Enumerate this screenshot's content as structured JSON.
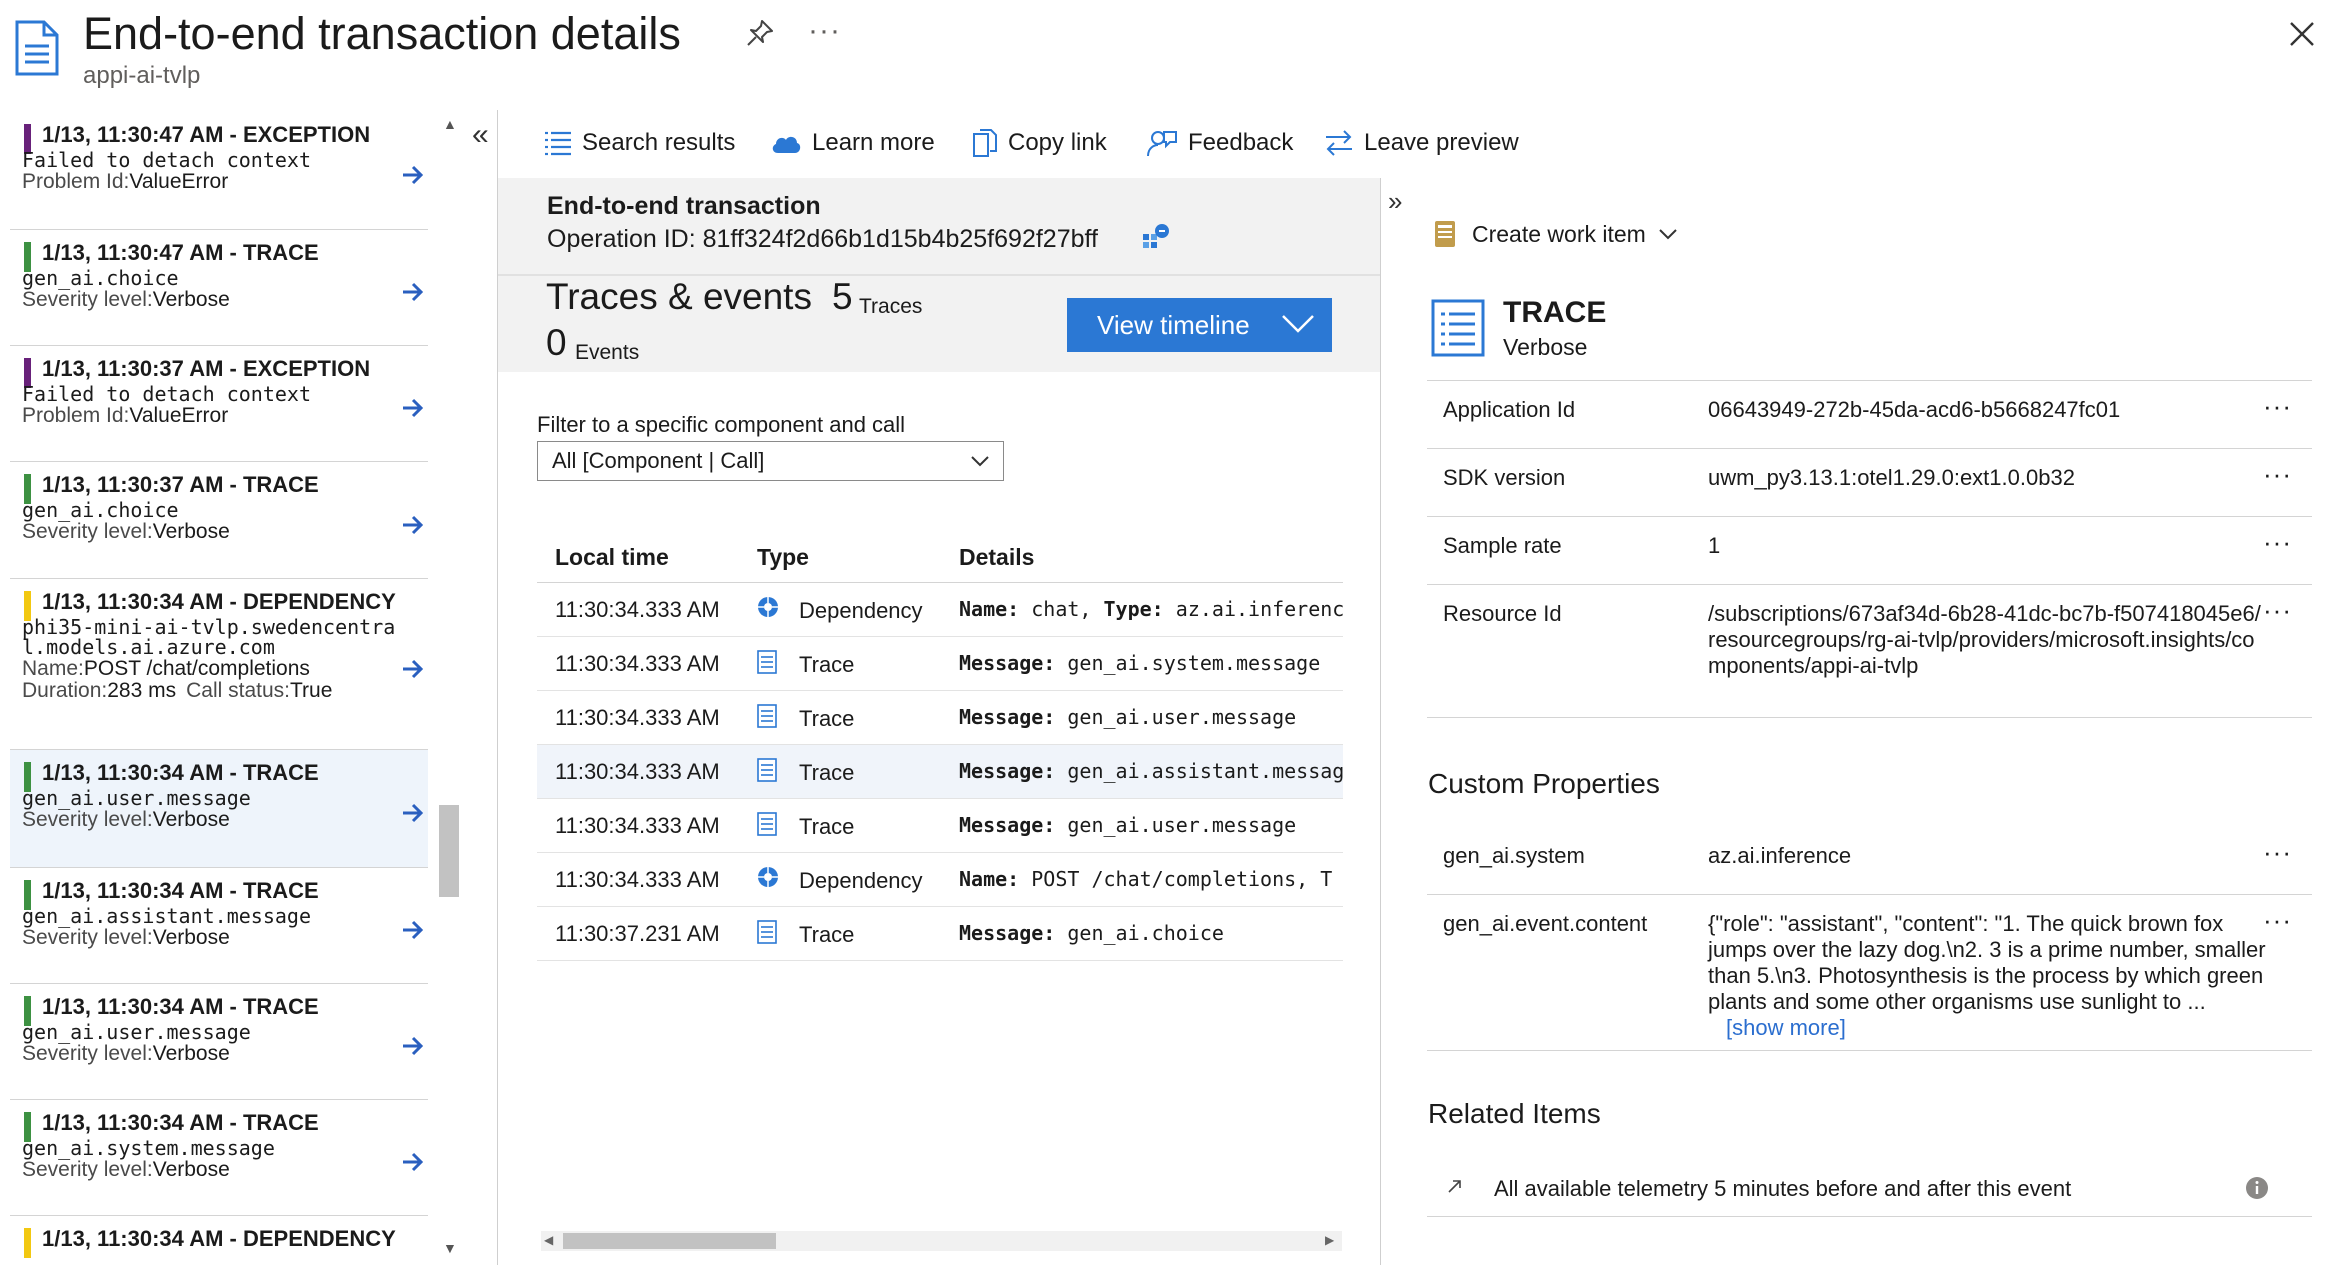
{
  "header": {
    "title": "End-to-end transaction details",
    "subtitle": "appi-ai-tvlp",
    "more": "···"
  },
  "left_list": {
    "items": [
      {
        "kind": "exception",
        "color": "#68217a",
        "title": "1/13, 11:30:47 AM - EXCEPTION",
        "lines": [
          {
            "mono": "Failed to detach context"
          },
          {
            "label": "Problem Id:",
            "value": "ValueError"
          }
        ]
      },
      {
        "kind": "trace",
        "color": "#3d9142",
        "title": "1/13, 11:30:47 AM - TRACE",
        "lines": [
          {
            "mono": "gen_ai.choice"
          },
          {
            "label": "Severity level:",
            "value": "Verbose"
          }
        ]
      },
      {
        "kind": "exception",
        "color": "#68217a",
        "title": "1/13, 11:30:37 AM - EXCEPTION",
        "lines": [
          {
            "mono": "Failed to detach context"
          },
          {
            "label": "Problem Id:",
            "value": "ValueError"
          }
        ]
      },
      {
        "kind": "trace",
        "color": "#3d9142",
        "title": "1/13, 11:30:37 AM - TRACE",
        "lines": [
          {
            "mono": "gen_ai.choice"
          },
          {
            "label": "Severity level:",
            "value": "Verbose"
          }
        ]
      },
      {
        "kind": "dependency",
        "color": "#f2c811",
        "title": "1/13, 11:30:34 AM - DEPENDENCY",
        "lines": [
          {
            "mono": "phi35-mini-ai-tvlp.swedencentra"
          },
          {
            "mono": "l.models.ai.azure.com"
          },
          {
            "label": "Name:",
            "value": "POST /chat/completions"
          },
          {
            "label": "Duration:",
            "value": "283 ms",
            "label2": "Call status:",
            "value2": "True"
          }
        ]
      },
      {
        "kind": "trace",
        "color": "#3d9142",
        "title": "1/13, 11:30:34 AM - TRACE",
        "lines": [
          {
            "mono": "gen_ai.user.message"
          },
          {
            "label": "Severity level:",
            "value": "Verbose"
          }
        ]
      },
      {
        "kind": "trace",
        "color": "#3d9142",
        "title": "1/13, 11:30:34 AM - TRACE",
        "lines": [
          {
            "mono": "gen_ai.assistant.message"
          },
          {
            "label": "Severity level:",
            "value": "Verbose"
          }
        ]
      },
      {
        "kind": "trace",
        "color": "#3d9142",
        "title": "1/13, 11:30:34 AM - TRACE",
        "lines": [
          {
            "mono": "gen_ai.user.message"
          },
          {
            "label": "Severity level:",
            "value": "Verbose"
          }
        ]
      },
      {
        "kind": "trace",
        "color": "#3d9142",
        "title": "1/13, 11:30:34 AM - TRACE",
        "lines": [
          {
            "mono": "gen_ai.system.message"
          },
          {
            "label": "Severity level:",
            "value": "Verbose"
          }
        ]
      },
      {
        "kind": "dependency",
        "color": "#f2c811",
        "title": "1/13, 11:30:34 AM - DEPENDENCY",
        "lines": []
      }
    ],
    "selected_index": 5
  },
  "toolbar": {
    "search_results": "Search results",
    "learn_more": "Learn more",
    "copy_link": "Copy link",
    "feedback": "Feedback",
    "leave_preview": "Leave preview"
  },
  "transaction": {
    "title": "End-to-end transaction",
    "operation_id": "Operation ID: 81ff324f2d66b1d15b4b25f692f27bff"
  },
  "summary": {
    "traces_title": "Traces & events",
    "traces_count": "5",
    "traces_label": "Traces",
    "events_count": "0",
    "events_label": "Events",
    "view_timeline": "View timeline"
  },
  "filter": {
    "label": "Filter to a specific component and call",
    "value": "All [Component | Call]"
  },
  "table": {
    "headers": [
      "Local time",
      "Type",
      "Details"
    ],
    "rows": [
      {
        "time": "11:30:34.333 AM",
        "type": "Dependency",
        "icon": "dependency-icon",
        "k1": "Name:",
        "v1": " chat, ",
        "k2": "Type:",
        "v2": " az.ai.inference"
      },
      {
        "time": "11:30:34.333 AM",
        "type": "Trace",
        "icon": "trace-icon",
        "k1": "Message:",
        "v1": " gen_ai.system.message",
        "k2": "",
        "v2": ""
      },
      {
        "time": "11:30:34.333 AM",
        "type": "Trace",
        "icon": "trace-icon",
        "k1": "Message:",
        "v1": " gen_ai.user.message",
        "k2": "",
        "v2": ""
      },
      {
        "time": "11:30:34.333 AM",
        "type": "Trace",
        "icon": "trace-icon",
        "k1": "Message:",
        "v1": " gen_ai.assistant.message",
        "k2": "",
        "v2": ""
      },
      {
        "time": "11:30:34.333 AM",
        "type": "Trace",
        "icon": "trace-icon",
        "k1": "Message:",
        "v1": " gen_ai.user.message",
        "k2": "",
        "v2": ""
      },
      {
        "time": "11:30:34.333 AM",
        "type": "Dependency",
        "icon": "dependency-icon",
        "k1": "Name:",
        "v1": " POST /chat/completions, T",
        "k2": "",
        "v2": ""
      },
      {
        "time": "11:30:37.231 AM",
        "type": "Trace",
        "icon": "trace-icon",
        "k1": "Message:",
        "v1": " gen_ai.choice",
        "k2": "",
        "v2": ""
      }
    ],
    "selected_index": 3
  },
  "detail": {
    "create_work_item": "Create work item",
    "type": "TRACE",
    "severity": "Verbose",
    "properties": [
      {
        "key": "Application Id",
        "value": "06643949-272b-45da-acd6-b5668247fc01"
      },
      {
        "key": "SDK version",
        "value": "uwm_py3.13.1:otel1.29.0:ext1.0.0b32"
      },
      {
        "key": "Sample rate",
        "value": "1"
      },
      {
        "key": "Resource Id",
        "value": "/subscriptions/673af34d-6b28-41dc-bc7b-f507418045e6/resourcegroups/rg-ai-tvlp/providers/microsoft.insights/components/appi-ai-tvlp"
      }
    ],
    "custom_title": "Custom Properties",
    "custom_properties": [
      {
        "key": "gen_ai.system",
        "value": "az.ai.inference"
      },
      {
        "key": "gen_ai.event.content",
        "value": "{\"role\": \"assistant\", \"content\": \"1. The quick brown fox jumps over the lazy dog.\\n2. 3 is a prime number, smaller than 5.\\n3. Photosynthesis is the process by which green plants and some other organisms use sunlight to ...",
        "link": "[show more]"
      }
    ],
    "related_title": "Related Items",
    "related_text": "All available telemetry 5 minutes before and after this event"
  },
  "colors": {
    "accent": "#2b78d4",
    "exception": "#68217a",
    "trace": "#3d9142",
    "dependency": "#f2c811",
    "arrow": "#2a5fbf"
  }
}
